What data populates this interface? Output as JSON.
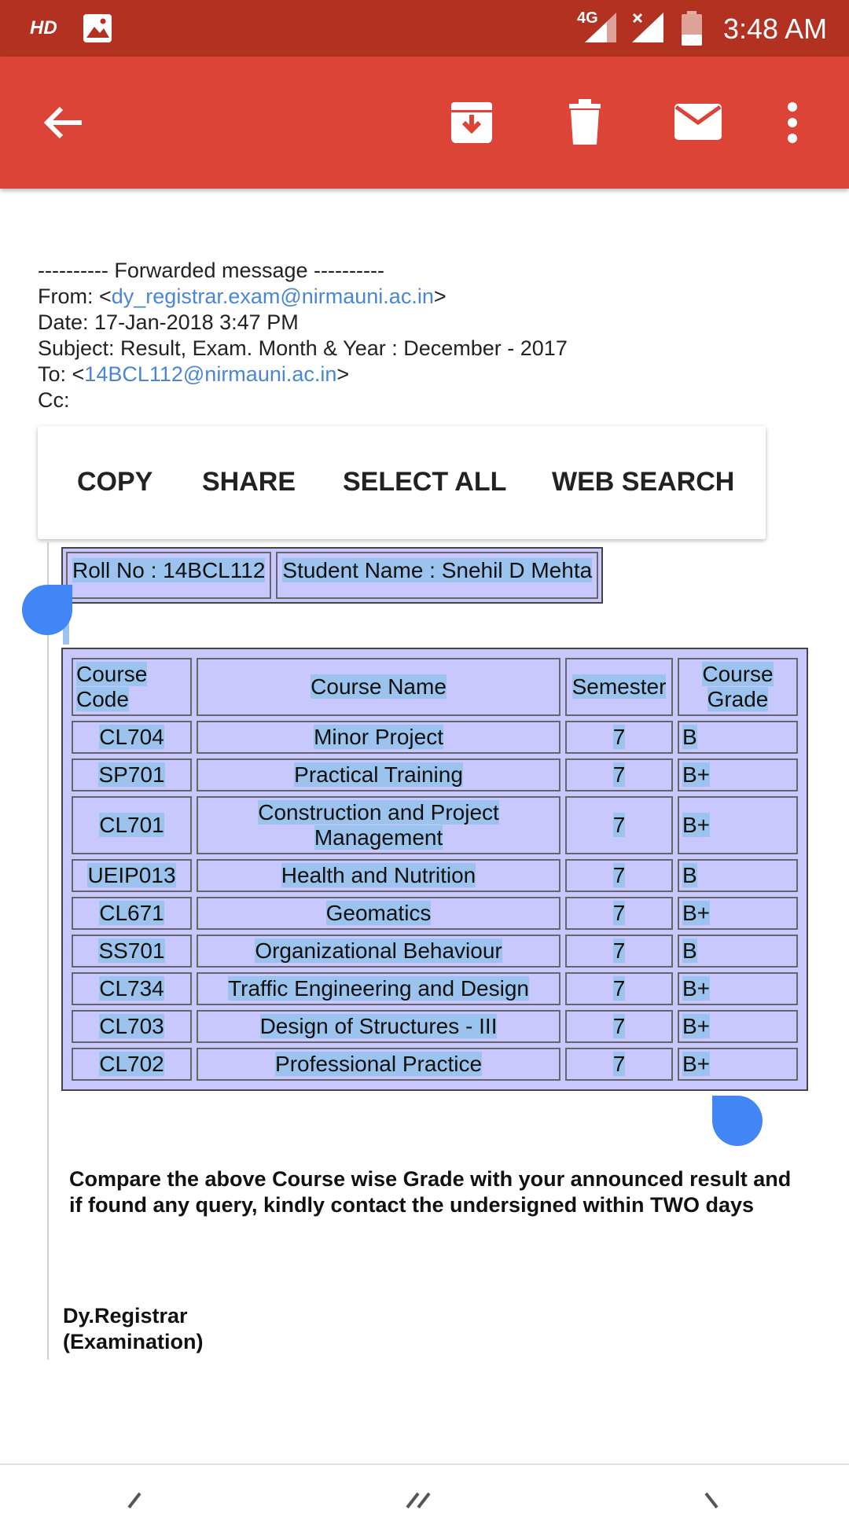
{
  "status_bar": {
    "hd": "HD",
    "network": "4G",
    "time": "3:48 AM"
  },
  "forward": {
    "divider": "---------- Forwarded message ----------",
    "from_label": "From: <",
    "from_email": "dy_registrar.exam@nirmauni.ac.in",
    "from_close": ">",
    "date": "Date: 17-Jan-2018 3:47 PM",
    "subject": "Subject: Result, Exam. Month & Year : December - 2017",
    "to_label": "To: <",
    "to_email": "14BCL112@nirmauni.ac.in",
    "to_close": ">",
    "cc": "Cc:"
  },
  "selection_toolbar": {
    "copy": "COPY",
    "share": "SHARE",
    "select_all": "SELECT ALL",
    "web_search": "WEB SEARCH"
  },
  "student": {
    "roll": "Roll No : 14BCL112",
    "name": "Student Name : Snehil D Mehta"
  },
  "table": {
    "headers": [
      "Course Code",
      "Course Name",
      "Semester",
      "Course Grade"
    ],
    "rows": [
      [
        "CL704",
        "Minor Project",
        "7",
        "B"
      ],
      [
        "SP701",
        "Practical Training",
        "7",
        "B+"
      ],
      [
        "CL701",
        "Construction and Project Management",
        "7",
        "B+"
      ],
      [
        "UEIP013",
        "Health and Nutrition",
        "7",
        "B"
      ],
      [
        "CL671",
        "Geomatics",
        "7",
        "B+"
      ],
      [
        "SS701",
        "Organizational Behaviour",
        "7",
        "B"
      ],
      [
        "CL734",
        "Traffic Engineering and Design",
        "7",
        "B+"
      ],
      [
        "CL703",
        "Design of Structures - III",
        "7",
        "B+"
      ],
      [
        "CL702",
        "Professional Practice",
        "7",
        "B+"
      ]
    ]
  },
  "notice": "Compare the above Course wise Grade with your announced result and if found any query, kindly contact the undersigned within TWO days",
  "signature": {
    "line1": "Dy.Registrar",
    "line2": "(Examination)"
  },
  "colors": {
    "status_bar": "#b33121",
    "app_bar": "#db4437",
    "link": "#4a86d8",
    "selection": "#9cc3ee",
    "table_bg": "#c8c8ff",
    "handle": "#4285f4"
  }
}
